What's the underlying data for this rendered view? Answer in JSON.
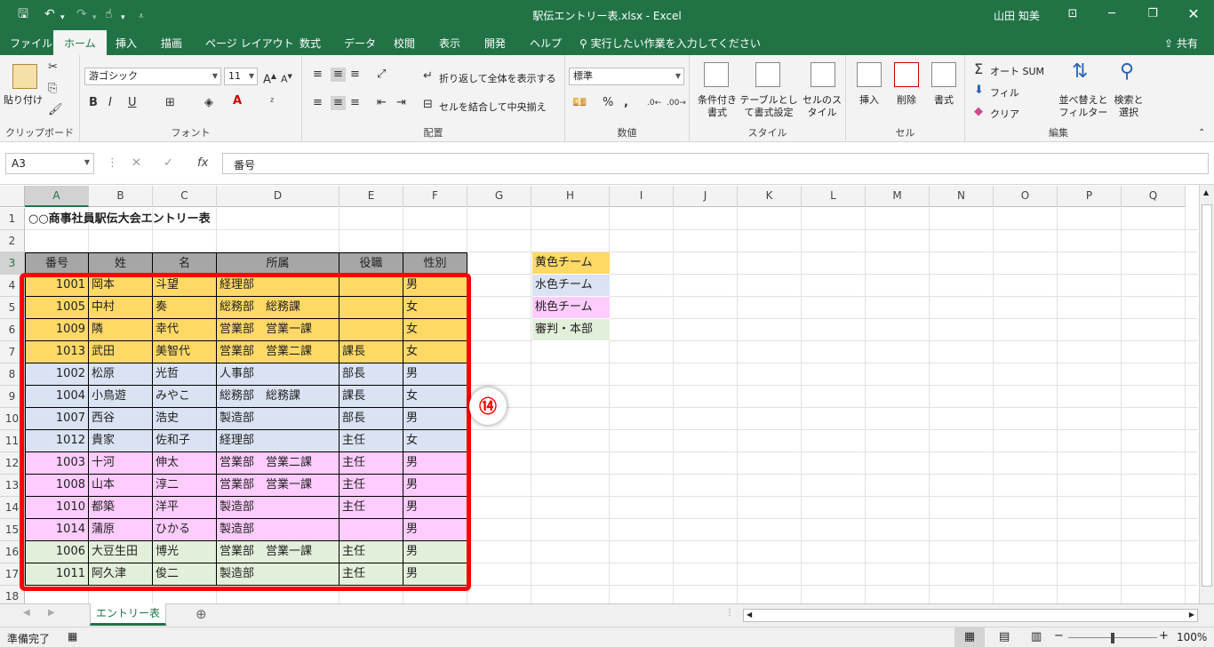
{
  "titlebar": {
    "doc_title": "駅伝エントリー表.xlsx  -  Excel",
    "user": "山田 知美"
  },
  "tabs": [
    "ファイル",
    "ホーム",
    "挿入",
    "描画",
    "ページ レイアウト",
    "数式",
    "データ",
    "校閲",
    "表示",
    "開発",
    "ヘルプ"
  ],
  "tell_me": "実行したい作業を入力してください",
  "share": "共有",
  "ribbon": {
    "clipboard": {
      "paste": "貼り付け",
      "label": "クリップボード"
    },
    "font": {
      "name": "游ゴシック",
      "size": "11",
      "label": "フォント",
      "bold": "B",
      "italic": "I",
      "underline": "U"
    },
    "alignment": {
      "wrap": "折り返して全体を表示する",
      "merge": "セルを結合して中央揃え",
      "label": "配置"
    },
    "number": {
      "format": "標準",
      "label": "数値"
    },
    "styles": {
      "cond": "条件付き書式",
      "table": "テーブルとして書式設定",
      "cell": "セルのスタイル",
      "label": "スタイル"
    },
    "cells": {
      "insert": "挿入",
      "delete": "削除",
      "format": "書式",
      "label": "セル"
    },
    "editing": {
      "autosum": "オート SUM",
      "fill": "フィル",
      "clear": "クリア",
      "sort": "並べ替えとフィルター",
      "find": "検索と選択",
      "label": "編集"
    }
  },
  "formula_bar": {
    "name_box": "A3",
    "formula": "番号"
  },
  "columns": [
    "A",
    "B",
    "C",
    "D",
    "E",
    "F",
    "G",
    "H",
    "I",
    "J",
    "K",
    "L",
    "M",
    "N",
    "O",
    "P",
    "Q"
  ],
  "rows": [
    "1",
    "2",
    "3",
    "4",
    "5",
    "6",
    "7",
    "8",
    "9",
    "10",
    "11",
    "12",
    "13",
    "14",
    "15",
    "16",
    "17",
    "18"
  ],
  "sheet": {
    "title": "○○商事社員駅伝大会エントリー表",
    "headers": [
      "番号",
      "姓",
      "名",
      "所属",
      "役職",
      "性別"
    ],
    "records": [
      {
        "num": "1001",
        "sei": "岡本",
        "mei": "斗望",
        "dept": "経理部",
        "pos": "",
        "sex": "男",
        "team": "yellow"
      },
      {
        "num": "1005",
        "sei": "中村",
        "mei": "奏",
        "dept": "総務部　総務課",
        "pos": "",
        "sex": "女",
        "team": "yellow"
      },
      {
        "num": "1009",
        "sei": "隣",
        "mei": "幸代",
        "dept": "営業部　営業一課",
        "pos": "",
        "sex": "女",
        "team": "yellow"
      },
      {
        "num": "1013",
        "sei": "武田",
        "mei": "美智代",
        "dept": "営業部　営業二課",
        "pos": "課長",
        "sex": "女",
        "team": "yellow"
      },
      {
        "num": "1002",
        "sei": "松原",
        "mei": "光哲",
        "dept": "人事部",
        "pos": "部長",
        "sex": "男",
        "team": "blue"
      },
      {
        "num": "1004",
        "sei": "小鳥遊",
        "mei": "みやこ",
        "dept": "総務部　総務課",
        "pos": "課長",
        "sex": "女",
        "team": "blue"
      },
      {
        "num": "1007",
        "sei": "西谷",
        "mei": "浩史",
        "dept": "製造部",
        "pos": "部長",
        "sex": "男",
        "team": "blue"
      },
      {
        "num": "1012",
        "sei": "貴家",
        "mei": "佐和子",
        "dept": "経理部",
        "pos": "主任",
        "sex": "女",
        "team": "blue"
      },
      {
        "num": "1003",
        "sei": "十河",
        "mei": "伸太",
        "dept": "営業部　営業二課",
        "pos": "主任",
        "sex": "男",
        "team": "pink"
      },
      {
        "num": "1008",
        "sei": "山本",
        "mei": "淳二",
        "dept": "営業部　営業一課",
        "pos": "主任",
        "sex": "男",
        "team": "pink"
      },
      {
        "num": "1010",
        "sei": "都築",
        "mei": "洋平",
        "dept": "製造部",
        "pos": "主任",
        "sex": "男",
        "team": "pink"
      },
      {
        "num": "1014",
        "sei": "蒲原",
        "mei": "ひかる",
        "dept": "製造部",
        "pos": "",
        "sex": "男",
        "team": "pink"
      },
      {
        "num": "1006",
        "sei": "大豆生田",
        "mei": "博光",
        "dept": "営業部　営業一課",
        "pos": "主任",
        "sex": "男",
        "team": "green"
      },
      {
        "num": "1011",
        "sei": "阿久津",
        "mei": "俊二",
        "dept": "製造部",
        "pos": "主任",
        "sex": "男",
        "team": "green"
      }
    ],
    "legend": [
      {
        "label": "黄色チーム",
        "team": "yellow"
      },
      {
        "label": "水色チーム",
        "team": "blue"
      },
      {
        "label": "桃色チーム",
        "team": "pink"
      },
      {
        "label": "審判・本部",
        "team": "green"
      }
    ]
  },
  "marker": "⑭",
  "sheet_tab": "エントリー表",
  "status": {
    "text": "準備完了",
    "zoom": "100%"
  },
  "colors": {
    "excel_green": "#217346",
    "yellow": "#ffd966",
    "blue": "#dae3f3",
    "pink": "#ffccff",
    "green": "#e2efda",
    "highlight": "#ff0000"
  }
}
